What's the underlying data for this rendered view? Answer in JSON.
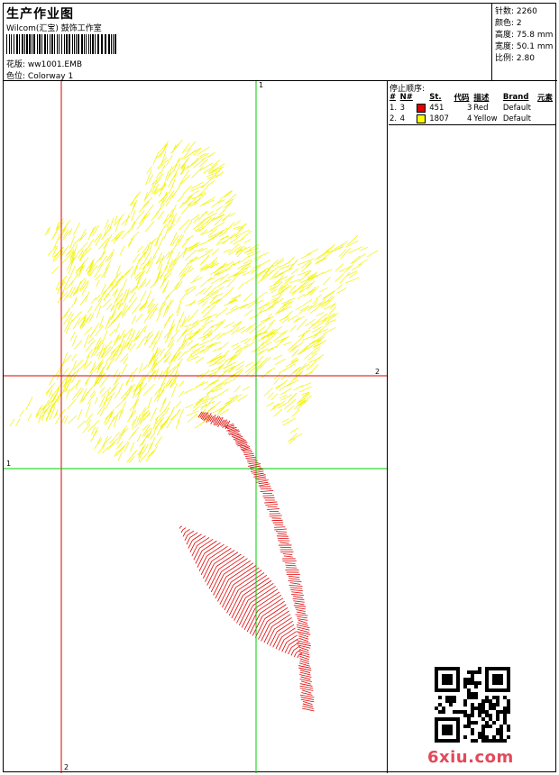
{
  "header": {
    "title": "生产作业图",
    "company": "Wilcom(汇宝) 鼓饰工作室",
    "design_label": "花版:",
    "design_value": "ww1001.EMB",
    "colorway_label": "色位:",
    "colorway_value": "Colorway 1"
  },
  "stats": [
    {
      "label": "针数:",
      "value": "2260"
    },
    {
      "label": "颜色:",
      "value": "2"
    },
    {
      "label": "高度:",
      "value": "75.8 mm"
    },
    {
      "label": "宽度:",
      "value": "50.1 mm"
    },
    {
      "label": "比例:",
      "value": "2.80"
    }
  ],
  "stop_sequence": {
    "title": "停止顺序:",
    "columns": [
      "#",
      "N#",
      "St.",
      "代码",
      "描述",
      "Brand",
      "元素"
    ],
    "rows": [
      {
        "idx": "1.",
        "n": "3",
        "color": "#e00000",
        "st": "451",
        "code": "3",
        "desc": "Red",
        "brand": "Default"
      },
      {
        "idx": "2.",
        "n": "4",
        "color": "#ffff00",
        "st": "1807",
        "code": "4",
        "desc": "Yellow",
        "brand": "Default"
      }
    ]
  },
  "guides": {
    "v1_label": "1",
    "v2_label": "2",
    "h1_label": "1",
    "h2_label": "2"
  },
  "colors": {
    "thread_red": "#e00000",
    "thread_yellow": "#f2f200",
    "guide_red": "#e00000",
    "guide_green": "#00cc00"
  },
  "watermark": "6xiu.com"
}
